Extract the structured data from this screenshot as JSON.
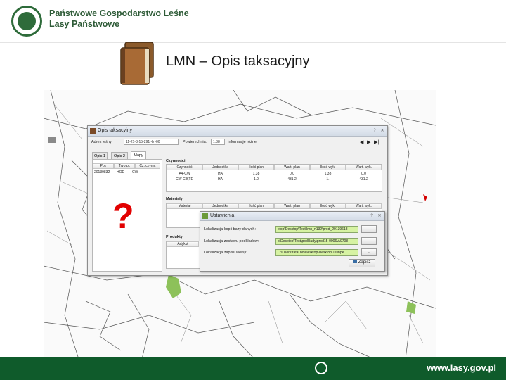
{
  "header": {
    "org_line1": "Państwowe Gospodarstwo Leśne",
    "org_line2": "Lasy Państwowe"
  },
  "slide": {
    "title": "LMN – Opis taksacyjny",
    "annotation": "?"
  },
  "main_window": {
    "title": "Opis taksacyjny",
    "adres_label": "Adres leśny:",
    "adres_value": "11-21-3-15-291 -b -00",
    "powierzchnia_label": "Powierzchnia:",
    "powierzchnia_value": "1.38",
    "info_label": "Informacje różne",
    "tabs": [
      "Opis 1",
      "Opis 2",
      "Mapy"
    ],
    "left_table": {
      "headers": [
        "Poz",
        "Tryb pl.",
        "Cz. czynn."
      ],
      "rows": [
        [
          "20139832",
          "HOD",
          "CW"
        ]
      ]
    },
    "czynnosci": {
      "label": "Czynności",
      "headers": [
        "Czynność",
        "Jednostka",
        "Ilość plan",
        "Wart. plan",
        "Ilość wyk.",
        "Wart. wyk."
      ],
      "rows": [
        [
          "A4-CW",
          "HA",
          "1.38",
          "0.0",
          "1.38",
          "0.0"
        ],
        [
          "CW-CIĘTE",
          "HA",
          "1.0",
          "431.2",
          "1.",
          "431.2"
        ]
      ]
    },
    "materialy": {
      "label": "Materiały",
      "headers": [
        "Materiał",
        "Jednostka",
        "Ilość plan",
        "Wart. plan",
        "Ilość wyk.",
        "Wart. wyk."
      ]
    },
    "produkty": {
      "label": "Produkty",
      "headers": [
        "Artykuł"
      ]
    }
  },
  "dialog": {
    "title": "Ustawienia",
    "rows": [
      {
        "label": "Lokalizacja kopii bazy danych:",
        "value": "ktop\\Desktop\\Test\\lmn_n132\\prod_20139618",
        "browse": "..."
      },
      {
        "label": "Lokalizacja zestawu podkładów:",
        "value": "b\\Desktop\\Test\\podkłady\\prod15-0006\\A9708",
        "browse": "..."
      },
      {
        "label": "Lokalizacja zapisu wersji:",
        "value": "C:\\Users\\rafal.bo\\Desktop\\Desktop\\Test\\pe",
        "browse": "..."
      }
    ],
    "save_label": "Zapisz"
  },
  "footer": {
    "url": "www.lasy.gov.pl"
  },
  "colors": {
    "brand_green": "#0f5b2b",
    "question_red": "#e20000",
    "field_green": "#d6f2a2"
  }
}
